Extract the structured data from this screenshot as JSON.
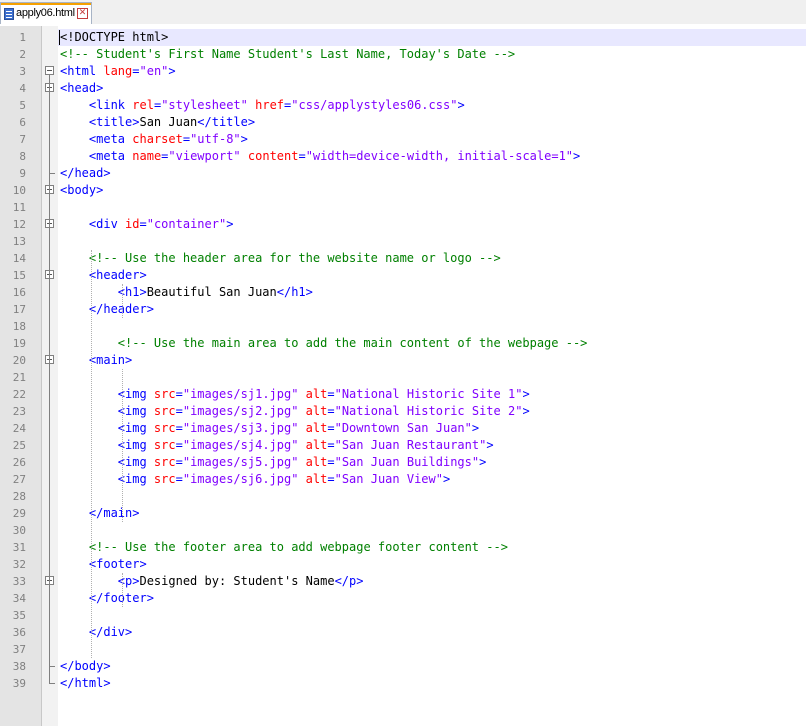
{
  "tab": {
    "filename": "apply06.html",
    "close_symbol": "✕"
  },
  "lines": [
    [
      {
        "c": "d",
        "t": "<!DOCTYPE html>"
      }
    ],
    [
      {
        "c": "c",
        "t": "<!-- Student's First Name Student's Last Name, Today's Date -->"
      }
    ],
    [
      {
        "c": "t",
        "t": "<html "
      },
      {
        "c": "a",
        "t": "lang"
      },
      {
        "c": "t",
        "t": "="
      },
      {
        "c": "v",
        "t": "\"en\""
      },
      {
        "c": "t",
        "t": ">"
      }
    ],
    [
      {
        "c": "t",
        "t": "<head>"
      }
    ],
    [
      {
        "c": "d",
        "t": "    "
      },
      {
        "c": "t",
        "t": "<link "
      },
      {
        "c": "a",
        "t": "rel"
      },
      {
        "c": "t",
        "t": "="
      },
      {
        "c": "v",
        "t": "\"stylesheet\""
      },
      {
        "c": "t",
        "t": " "
      },
      {
        "c": "a",
        "t": "href"
      },
      {
        "c": "t",
        "t": "="
      },
      {
        "c": "v",
        "t": "\"css/applystyles06.css\""
      },
      {
        "c": "t",
        "t": ">"
      }
    ],
    [
      {
        "c": "d",
        "t": "    "
      },
      {
        "c": "t",
        "t": "<title>"
      },
      {
        "c": "d",
        "t": "San Juan"
      },
      {
        "c": "t",
        "t": "</title>"
      }
    ],
    [
      {
        "c": "d",
        "t": "    "
      },
      {
        "c": "t",
        "t": "<meta "
      },
      {
        "c": "a",
        "t": "charset"
      },
      {
        "c": "t",
        "t": "="
      },
      {
        "c": "v",
        "t": "\"utf-8\""
      },
      {
        "c": "t",
        "t": ">"
      }
    ],
    [
      {
        "c": "d",
        "t": "    "
      },
      {
        "c": "t",
        "t": "<meta "
      },
      {
        "c": "a",
        "t": "name"
      },
      {
        "c": "t",
        "t": "="
      },
      {
        "c": "v",
        "t": "\"viewport\""
      },
      {
        "c": "t",
        "t": " "
      },
      {
        "c": "a",
        "t": "content"
      },
      {
        "c": "t",
        "t": "="
      },
      {
        "c": "v",
        "t": "\"width=device-width, initial-scale=1\""
      },
      {
        "c": "t",
        "t": ">"
      }
    ],
    [
      {
        "c": "t",
        "t": "</head>"
      }
    ],
    [
      {
        "c": "t",
        "t": "<body>"
      }
    ],
    [],
    [
      {
        "c": "d",
        "t": "    "
      },
      {
        "c": "t",
        "t": "<div "
      },
      {
        "c": "a",
        "t": "id"
      },
      {
        "c": "t",
        "t": "="
      },
      {
        "c": "v",
        "t": "\"container\""
      },
      {
        "c": "t",
        "t": ">"
      }
    ],
    [],
    [
      {
        "c": "d",
        "t": "    "
      },
      {
        "c": "c",
        "t": "<!-- Use the header area for the website name or logo -->"
      }
    ],
    [
      {
        "c": "d",
        "t": "    "
      },
      {
        "c": "t",
        "t": "<header>"
      }
    ],
    [
      {
        "c": "d",
        "t": "        "
      },
      {
        "c": "t",
        "t": "<h1>"
      },
      {
        "c": "d",
        "t": "Beautiful San Juan"
      },
      {
        "c": "t",
        "t": "</h1>"
      }
    ],
    [
      {
        "c": "d",
        "t": "    "
      },
      {
        "c": "t",
        "t": "</header>"
      }
    ],
    [],
    [
      {
        "c": "d",
        "t": "        "
      },
      {
        "c": "c",
        "t": "<!-- Use the main area to add the main content of the webpage -->"
      }
    ],
    [
      {
        "c": "d",
        "t": "    "
      },
      {
        "c": "t",
        "t": "<main>"
      }
    ],
    [],
    [
      {
        "c": "d",
        "t": "        "
      },
      {
        "c": "t",
        "t": "<img "
      },
      {
        "c": "a",
        "t": "src"
      },
      {
        "c": "t",
        "t": "="
      },
      {
        "c": "v",
        "t": "\"images/sj1.jpg\""
      },
      {
        "c": "t",
        "t": " "
      },
      {
        "c": "a",
        "t": "alt"
      },
      {
        "c": "t",
        "t": "="
      },
      {
        "c": "v",
        "t": "\"National Historic Site 1\""
      },
      {
        "c": "t",
        "t": ">"
      }
    ],
    [
      {
        "c": "d",
        "t": "        "
      },
      {
        "c": "t",
        "t": "<img "
      },
      {
        "c": "a",
        "t": "src"
      },
      {
        "c": "t",
        "t": "="
      },
      {
        "c": "v",
        "t": "\"images/sj2.jpg\""
      },
      {
        "c": "t",
        "t": " "
      },
      {
        "c": "a",
        "t": "alt"
      },
      {
        "c": "t",
        "t": "="
      },
      {
        "c": "v",
        "t": "\"National Historic Site 2\""
      },
      {
        "c": "t",
        "t": ">"
      }
    ],
    [
      {
        "c": "d",
        "t": "        "
      },
      {
        "c": "t",
        "t": "<img "
      },
      {
        "c": "a",
        "t": "src"
      },
      {
        "c": "t",
        "t": "="
      },
      {
        "c": "v",
        "t": "\"images/sj3.jpg\""
      },
      {
        "c": "t",
        "t": " "
      },
      {
        "c": "a",
        "t": "alt"
      },
      {
        "c": "t",
        "t": "="
      },
      {
        "c": "v",
        "t": "\"Downtown San Juan\""
      },
      {
        "c": "t",
        "t": ">"
      }
    ],
    [
      {
        "c": "d",
        "t": "        "
      },
      {
        "c": "t",
        "t": "<img "
      },
      {
        "c": "a",
        "t": "src"
      },
      {
        "c": "t",
        "t": "="
      },
      {
        "c": "v",
        "t": "\"images/sj4.jpg\""
      },
      {
        "c": "t",
        "t": " "
      },
      {
        "c": "a",
        "t": "alt"
      },
      {
        "c": "t",
        "t": "="
      },
      {
        "c": "v",
        "t": "\"San Juan Restaurant\""
      },
      {
        "c": "t",
        "t": ">"
      }
    ],
    [
      {
        "c": "d",
        "t": "        "
      },
      {
        "c": "t",
        "t": "<img "
      },
      {
        "c": "a",
        "t": "src"
      },
      {
        "c": "t",
        "t": "="
      },
      {
        "c": "v",
        "t": "\"images/sj5.jpg\""
      },
      {
        "c": "t",
        "t": " "
      },
      {
        "c": "a",
        "t": "alt"
      },
      {
        "c": "t",
        "t": "="
      },
      {
        "c": "v",
        "t": "\"San Juan Buildings\""
      },
      {
        "c": "t",
        "t": ">"
      }
    ],
    [
      {
        "c": "d",
        "t": "        "
      },
      {
        "c": "t",
        "t": "<img "
      },
      {
        "c": "a",
        "t": "src"
      },
      {
        "c": "t",
        "t": "="
      },
      {
        "c": "v",
        "t": "\"images/sj6.jpg\""
      },
      {
        "c": "t",
        "t": " "
      },
      {
        "c": "a",
        "t": "alt"
      },
      {
        "c": "t",
        "t": "="
      },
      {
        "c": "v",
        "t": "\"San Juan View\""
      },
      {
        "c": "t",
        "t": ">"
      }
    ],
    [],
    [
      {
        "c": "d",
        "t": "    "
      },
      {
        "c": "t",
        "t": "</main>"
      }
    ],
    [],
    [
      {
        "c": "d",
        "t": "    "
      },
      {
        "c": "c",
        "t": "<!-- Use the footer area to add webpage footer content -->"
      }
    ],
    [
      {
        "c": "d",
        "t": "    "
      },
      {
        "c": "t",
        "t": "<footer>"
      }
    ],
    [
      {
        "c": "d",
        "t": "        "
      },
      {
        "c": "t",
        "t": "<p>"
      },
      {
        "c": "d",
        "t": "Designed by: Student's Name"
      },
      {
        "c": "t",
        "t": "</p>"
      }
    ],
    [
      {
        "c": "d",
        "t": "    "
      },
      {
        "c": "t",
        "t": "</footer>"
      }
    ],
    [],
    [
      {
        "c": "d",
        "t": "    "
      },
      {
        "c": "t",
        "t": "</div>"
      }
    ],
    [],
    [
      {
        "c": "t",
        "t": "</body>"
      }
    ],
    [
      {
        "c": "t",
        "t": "</html>"
      }
    ]
  ],
  "colors": {
    "tag": "#0000ff",
    "attribute": "#ff0000",
    "value": "#8000ff",
    "comment": "#008000",
    "text": "#000000",
    "current_line": "#e8e8ff",
    "tab_accent": "#f5a000"
  }
}
